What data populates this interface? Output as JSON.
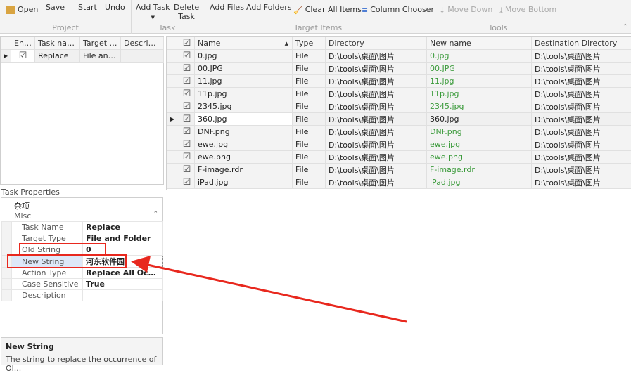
{
  "ribbon": {
    "open": "Open",
    "save": "Save",
    "start": "Start",
    "undo": "Undo",
    "project": "Project",
    "add_task": "Add Task",
    "delete_task": "Delete Task",
    "task": "Task",
    "add_files": "Add Files",
    "add_folders": "Add Folders",
    "clear_all": "Clear All Items",
    "column_chooser": "Column Chooser",
    "target_items": "Target Items",
    "move_down": "Move Down",
    "move_bottom": "Move Bottom",
    "tools": "Tools"
  },
  "tasks": {
    "headers": [
      "Ena...",
      "Task name",
      "Target t...",
      "Description"
    ],
    "rows": [
      {
        "name": "Replace",
        "target": "File and ...",
        "description": ""
      }
    ]
  },
  "items": {
    "headers": [
      "Name",
      "Type",
      "Directory",
      "New name",
      "Destination Directory"
    ],
    "rows": [
      {
        "name": "0.jpg",
        "type": "File",
        "dir": "D:\\tools\\桌面\\图片",
        "new": "0.jpg",
        "dest": "D:\\tools\\桌面\\图片"
      },
      {
        "name": "00.JPG",
        "type": "File",
        "dir": "D:\\tools\\桌面\\图片",
        "new": "00.JPG",
        "dest": "D:\\tools\\桌面\\图片"
      },
      {
        "name": "11.jpg",
        "type": "File",
        "dir": "D:\\tools\\桌面\\图片",
        "new": "11.jpg",
        "dest": "D:\\tools\\桌面\\图片"
      },
      {
        "name": "11p.jpg",
        "type": "File",
        "dir": "D:\\tools\\桌面\\图片",
        "new": "11p.jpg",
        "dest": "D:\\tools\\桌面\\图片"
      },
      {
        "name": "2345.jpg",
        "type": "File",
        "dir": "D:\\tools\\桌面\\图片",
        "new": "2345.jpg",
        "dest": "D:\\tools\\桌面\\图片"
      },
      {
        "name": "360.jpg",
        "type": "File",
        "dir": "D:\\tools\\桌面\\图片",
        "new": "360.jpg",
        "dest": "D:\\tools\\桌面\\图片"
      },
      {
        "name": "DNF.png",
        "type": "File",
        "dir": "D:\\tools\\桌面\\图片",
        "new": "DNF.png",
        "dest": "D:\\tools\\桌面\\图片"
      },
      {
        "name": "ewe.jpg",
        "type": "File",
        "dir": "D:\\tools\\桌面\\图片",
        "new": "ewe.jpg",
        "dest": "D:\\tools\\桌面\\图片"
      },
      {
        "name": "ewe.png",
        "type": "File",
        "dir": "D:\\tools\\桌面\\图片",
        "new": "ewe.png",
        "dest": "D:\\tools\\桌面\\图片"
      },
      {
        "name": "F-image.rdr",
        "type": "File",
        "dir": "D:\\tools\\桌面\\图片",
        "new": "F-image.rdr",
        "dest": "D:\\tools\\桌面\\图片"
      },
      {
        "name": "iPad.jpg",
        "type": "File",
        "dir": "D:\\tools\\桌面\\图片",
        "new": "iPad.jpg",
        "dest": "D:\\tools\\桌面\\图片"
      }
    ]
  },
  "props": {
    "title": "Task Properties",
    "category_cn": "杂项",
    "category": "Misc",
    "rows": [
      {
        "name": "Task Name",
        "value": "Replace"
      },
      {
        "name": "Target Type",
        "value": "File and Folder"
      },
      {
        "name": "Old String",
        "value": "0"
      },
      {
        "name": "New String",
        "value": "河东软件园"
      },
      {
        "name": "Action Type",
        "value": "Replace All Occurr..."
      },
      {
        "name": "Case Sensitive",
        "value": "True"
      },
      {
        "name": "Description",
        "value": ""
      }
    ],
    "help_title": "New String",
    "help_text": "The string to replace the occurrence of Ol..."
  }
}
